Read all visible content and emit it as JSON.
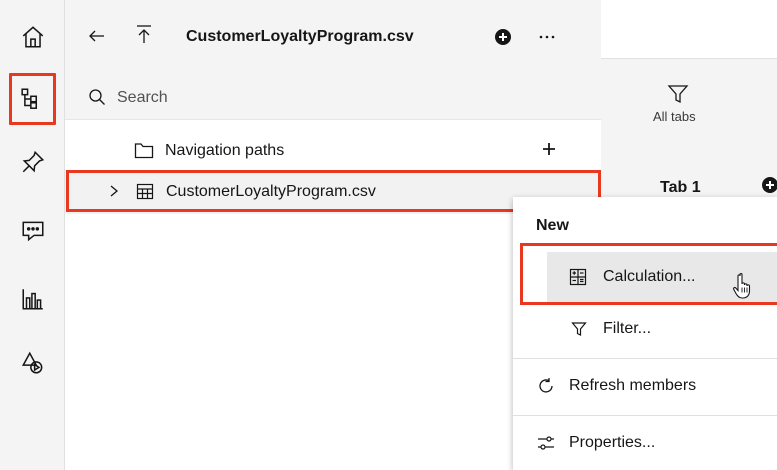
{
  "rail": {
    "items": [
      {
        "name": "home",
        "icon": "home-icon"
      },
      {
        "name": "data-sources",
        "icon": "data-tree-icon"
      },
      {
        "name": "pin",
        "icon": "pin-icon"
      },
      {
        "name": "chat",
        "icon": "chat-icon"
      },
      {
        "name": "visualizations",
        "icon": "chart-bar-icon"
      },
      {
        "name": "assets",
        "icon": "shapes-icon"
      }
    ]
  },
  "panel": {
    "title": "CustomerLoyaltyProgram.csv",
    "search_placeholder": "Search",
    "tree": {
      "navigation_paths": "Navigation paths",
      "datasource": "CustomerLoyaltyProgram.csv"
    }
  },
  "right": {
    "all_tabs": "All tabs",
    "tab1": "Tab 1"
  },
  "menu": {
    "heading": "New",
    "items": {
      "calculation": "Calculation...",
      "filter": "Filter...",
      "refresh": "Refresh members",
      "properties": "Properties..."
    }
  },
  "colors": {
    "highlight": "#e8381f"
  }
}
